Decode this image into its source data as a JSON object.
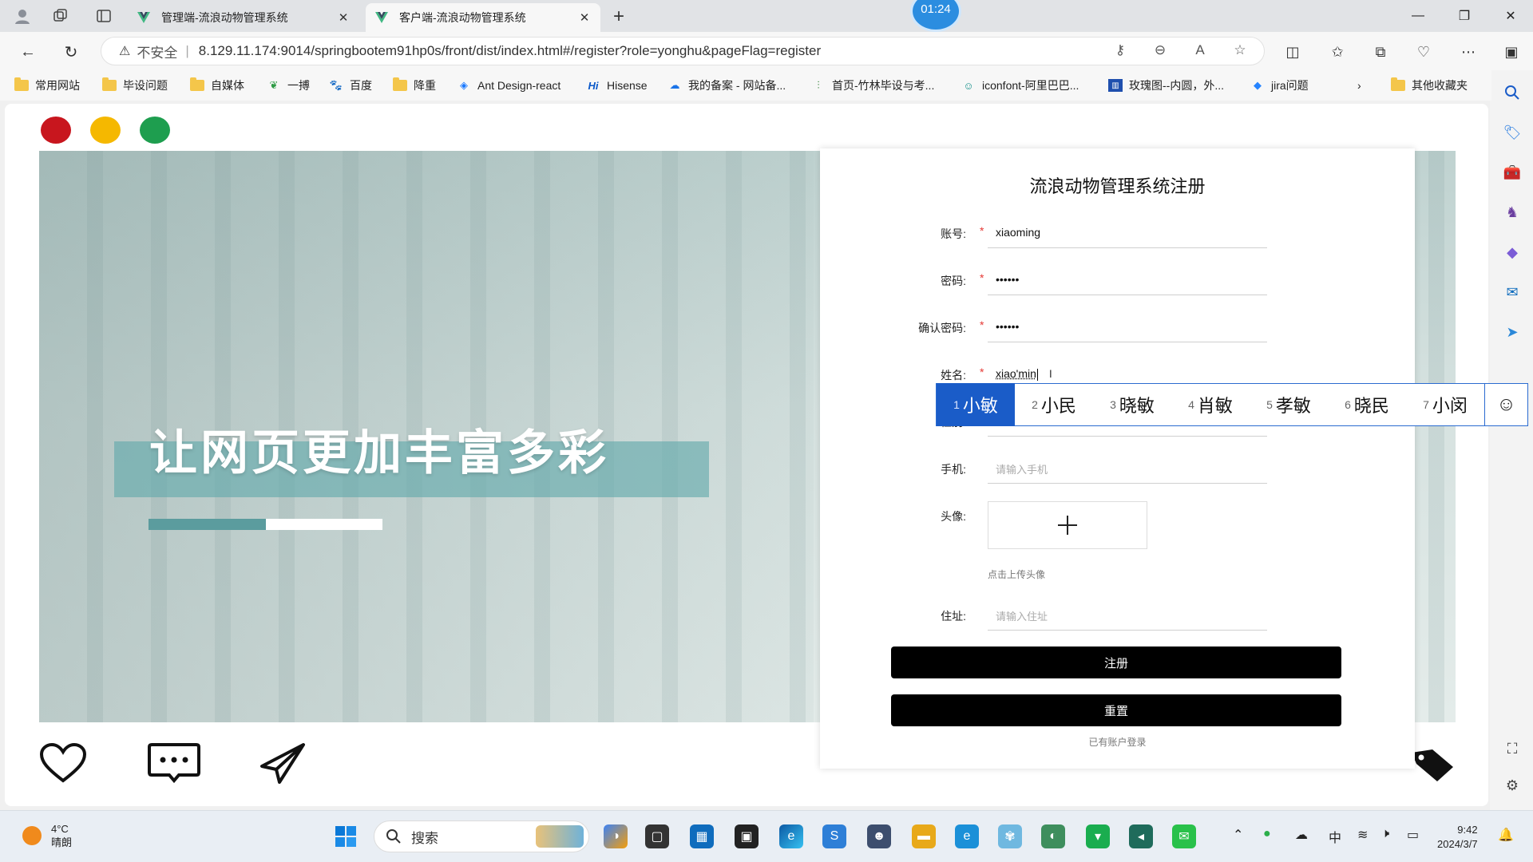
{
  "browser": {
    "tabs": [
      {
        "title": "管理端-流浪动物管理系统",
        "active": false
      },
      {
        "title": "客户端-流浪动物管理系统",
        "active": true
      }
    ],
    "timer": "01:24",
    "address": {
      "security": "不安全",
      "url": "8.129.11.174:9014/springbootem91hp0s/front/dist/index.html#/register?role=yonghu&pageFlag=register"
    },
    "bookmarks": [
      {
        "label": "常用网站",
        "icon": "folder-icon"
      },
      {
        "label": "毕设问题",
        "icon": "folder-icon"
      },
      {
        "label": "自媒体",
        "icon": "folder-icon"
      },
      {
        "label": "一搏",
        "icon": "leaf-icon"
      },
      {
        "label": "百度",
        "icon": "baidu-icon"
      },
      {
        "label": "降重",
        "icon": "folder-icon"
      },
      {
        "label": "Ant Design-react",
        "icon": "antd-icon"
      },
      {
        "label": "Hisense",
        "icon": "hisense-icon"
      },
      {
        "label": "我的备案 - 网站备...",
        "icon": "cloud-icon"
      },
      {
        "label": "首页-竹林毕设与考...",
        "icon": "bamboo-icon"
      },
      {
        "label": "iconfont-阿里巴巴...",
        "icon": "iconfont-icon"
      },
      {
        "label": "玫瑰图--内圆，外...",
        "icon": "chart-icon"
      },
      {
        "label": "jira问题",
        "icon": "jira-icon"
      },
      {
        "label": "其他收藏夹",
        "icon": "folder-icon"
      }
    ]
  },
  "hero": {
    "title": "让网页更加丰富多彩",
    "progress": 0.5
  },
  "form": {
    "title": "流浪动物管理系统注册",
    "fields": {
      "account": {
        "label": "账号:",
        "value": "xiaoming",
        "required": "*"
      },
      "password": {
        "label": "密码:",
        "value": "••••••",
        "required": "*"
      },
      "confirm": {
        "label": "确认密码:",
        "value": "••••••",
        "required": "*"
      },
      "name": {
        "label": "姓名:",
        "value": "xiao'min",
        "required": "*"
      },
      "gender": {
        "label": "性别:"
      },
      "phone": {
        "label": "手机:",
        "placeholder": "请输入手机"
      },
      "avatar": {
        "label": "头像:",
        "hint": "点击上传头像"
      },
      "address": {
        "label": "住址:",
        "placeholder": "请输入住址"
      }
    },
    "register_label": "注册",
    "reset_label": "重置",
    "login_link": "已有账户登录"
  },
  "ime": {
    "candidates": [
      {
        "n": "1",
        "text": "小敏"
      },
      {
        "n": "2",
        "text": "小民"
      },
      {
        "n": "3",
        "text": "晓敏"
      },
      {
        "n": "4",
        "text": "肖敏"
      },
      {
        "n": "5",
        "text": "孝敏"
      },
      {
        "n": "6",
        "text": "晓民"
      },
      {
        "n": "7",
        "text": "小闵"
      }
    ]
  },
  "taskbar": {
    "weather_temp": "4°C",
    "weather_desc": "晴朗",
    "search_label": "搜索",
    "ime_mode": "中",
    "time": "9:42",
    "date": "2024/3/7"
  },
  "colors": {
    "dot_red": "#c8161e",
    "dot_yellow": "#f5b800",
    "dot_green": "#1e9e4f",
    "hero_accent": "#5b9c9e",
    "ime_selected": "#1a5cc8"
  }
}
